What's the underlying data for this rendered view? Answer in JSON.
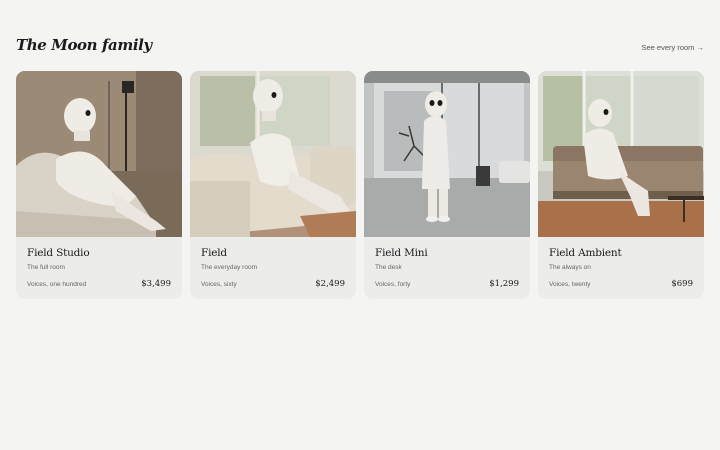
{
  "header": {
    "title": "The Moon family",
    "see_all": "See every room →"
  },
  "products": [
    {
      "name": "Field Studio",
      "subtitle": "The full room",
      "voices": "Voices, one hundred",
      "price": "$3,499"
    },
    {
      "name": "Field",
      "subtitle": "The everyday room",
      "voices": "Voices, sixty",
      "price": "$2,499"
    },
    {
      "name": "Field Mini",
      "subtitle": "The desk",
      "voices": "Voices, forty",
      "price": "$1,299"
    },
    {
      "name": "Field Ambient",
      "subtitle": "The always on",
      "voices": "Voices, twenty",
      "price": "$699"
    }
  ]
}
